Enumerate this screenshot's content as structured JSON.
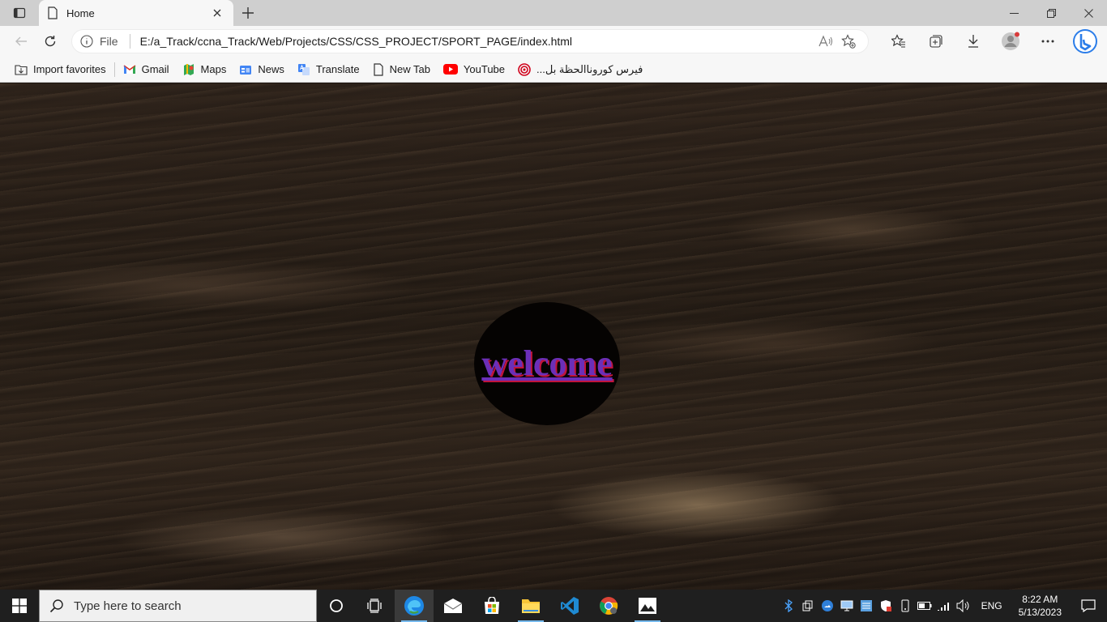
{
  "browser": {
    "tab": {
      "title": "Home"
    },
    "address": {
      "site_label": "File",
      "url": "E:/a_Track/ccna_Track/Web/Projects/CSS/CSS_PROJECT/SPORT_PAGE/index.html"
    },
    "favorites": [
      {
        "label": "Import favorites",
        "icon": "import-icon"
      },
      {
        "label": "Gmail",
        "icon": "gmail-icon"
      },
      {
        "label": "Maps",
        "icon": "maps-icon"
      },
      {
        "label": "News",
        "icon": "news-icon"
      },
      {
        "label": "Translate",
        "icon": "translate-icon"
      },
      {
        "label": "New Tab",
        "icon": "page-icon"
      },
      {
        "label": "YouTube",
        "icon": "youtube-icon"
      },
      {
        "label": "فيرس كوروناالحظة بل...",
        "icon": "target-icon"
      }
    ]
  },
  "page": {
    "welcome_text": "welcome",
    "colors": {
      "link": "#6b2fb8",
      "shadow": "#c0143c",
      "circle": "#050302"
    }
  },
  "taskbar": {
    "search_placeholder": "Type here to search",
    "language": "ENG",
    "time": "8:22 AM",
    "date": "5/13/2023"
  }
}
